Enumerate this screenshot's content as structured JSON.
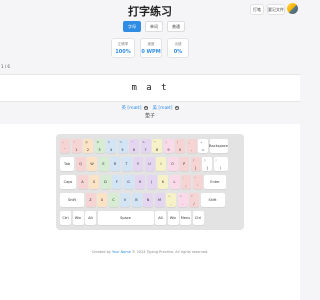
{
  "app": {
    "title": "打字练习"
  },
  "top_buttons": {
    "tab1": "打笔",
    "tab2": "要记文件"
  },
  "modes": [
    "字母",
    "单词",
    "普通"
  ],
  "stats": [
    {
      "label": "正确率",
      "value": "100%"
    },
    {
      "label": "速度",
      "value": "0 WPM"
    },
    {
      "label": "出错",
      "value": "0%"
    }
  ],
  "progress": "1 / 6",
  "word": "m a t",
  "phonetics": [
    {
      "label": "英 [mæt]"
    },
    {
      "label": "美 [mæt]"
    }
  ],
  "meaning": "垫子",
  "keyboard": {
    "row1": [
      {
        "s": "~",
        "m": "`",
        "c": "c1",
        "w": 10
      },
      {
        "s": "!",
        "m": "1",
        "c": "c1",
        "w": 10
      },
      {
        "s": "@",
        "m": "2",
        "c": "c2",
        "w": 10
      },
      {
        "s": "#",
        "m": "3",
        "c": "c3",
        "w": 10
      },
      {
        "s": "$",
        "m": "4",
        "c": "c4",
        "w": 10
      },
      {
        "s": "%",
        "m": "5",
        "c": "c4",
        "w": 10
      },
      {
        "s": "^",
        "m": "6",
        "c": "c5",
        "w": 10
      },
      {
        "s": "&",
        "m": "7",
        "c": "c5",
        "w": 10
      },
      {
        "s": "*",
        "m": "8",
        "c": "c6",
        "w": 10
      },
      {
        "s": "(",
        "m": "9",
        "c": "c7",
        "w": 10
      },
      {
        "s": ")",
        "m": "0",
        "c": "c1",
        "w": 10
      },
      {
        "s": "_",
        "m": "-",
        "c": "c1",
        "w": 10
      },
      {
        "s": "+",
        "m": "=",
        "c": "",
        "w": 10
      },
      {
        "s": "",
        "m": "Backspace",
        "c": "",
        "w": 18
      }
    ],
    "row2": [
      {
        "s": "",
        "m": "Tab",
        "c": "",
        "w": 14
      },
      {
        "s": "",
        "m": "Q",
        "c": "c1",
        "w": 10
      },
      {
        "s": "",
        "m": "W",
        "c": "c2",
        "w": 10
      },
      {
        "s": "",
        "m": "E",
        "c": "c3",
        "w": 10
      },
      {
        "s": "",
        "m": "R",
        "c": "c4",
        "w": 10
      },
      {
        "s": "",
        "m": "T",
        "c": "c4",
        "w": 10
      },
      {
        "s": "",
        "m": "Y",
        "c": "c5",
        "w": 10
      },
      {
        "s": "",
        "m": "U",
        "c": "c5",
        "w": 10
      },
      {
        "s": "",
        "m": "I",
        "c": "c6",
        "w": 10
      },
      {
        "s": "",
        "m": "O",
        "c": "c7",
        "w": 10
      },
      {
        "s": "",
        "m": "P",
        "c": "c1",
        "w": 10
      },
      {
        "s": "{",
        "m": "[",
        "c": "c1",
        "w": 10
      },
      {
        "s": "}",
        "m": "]",
        "c": "",
        "w": 10
      },
      {
        "s": "|",
        "m": "\\",
        "c": "",
        "w": 14
      }
    ],
    "row3": [
      {
        "s": "",
        "m": "Caps",
        "c": "",
        "w": 16
      },
      {
        "s": "",
        "m": "A",
        "c": "c1",
        "w": 10
      },
      {
        "s": "",
        "m": "S",
        "c": "c2",
        "w": 10
      },
      {
        "s": "",
        "m": "D",
        "c": "c3",
        "w": 10
      },
      {
        "s": "",
        "m": "F",
        "c": "c4",
        "w": 10
      },
      {
        "s": "",
        "m": "G",
        "c": "c4",
        "w": 10
      },
      {
        "s": "",
        "m": "H",
        "c": "c5",
        "w": 10
      },
      {
        "s": "",
        "m": "J",
        "c": "c5",
        "w": 10
      },
      {
        "s": "",
        "m": "K",
        "c": "c6",
        "w": 10
      },
      {
        "s": "",
        "m": "L",
        "c": "c7",
        "w": 10
      },
      {
        "s": ":",
        "m": ";",
        "c": "c1",
        "w": 10
      },
      {
        "s": "\"",
        "m": "'",
        "c": "c1",
        "w": 10
      },
      {
        "s": "",
        "m": "Enter",
        "c": "",
        "w": 22
      }
    ],
    "row4": [
      {
        "s": "",
        "m": "Shift",
        "c": "",
        "w": 24
      },
      {
        "s": "",
        "m": "Z",
        "c": "c1",
        "w": 10
      },
      {
        "s": "",
        "m": "X",
        "c": "c2",
        "w": 10
      },
      {
        "s": "",
        "m": "C",
        "c": "c3",
        "w": 10
      },
      {
        "s": "",
        "m": "V",
        "c": "c4",
        "w": 10
      },
      {
        "s": "",
        "m": "B",
        "c": "c4",
        "w": 10
      },
      {
        "s": "",
        "m": "N",
        "c": "c5",
        "w": 10
      },
      {
        "s": "",
        "m": "M",
        "c": "c5",
        "w": 10
      },
      {
        "s": "<",
        "m": ",",
        "c": "c6",
        "w": 10
      },
      {
        "s": ">",
        "m": ".",
        "c": "c7",
        "w": 10
      },
      {
        "s": "?",
        "m": "/",
        "c": "c1",
        "w": 10
      },
      {
        "s": "",
        "m": "Shift",
        "c": "",
        "w": 24
      }
    ],
    "row5": [
      {
        "s": "",
        "m": "Ctrl",
        "c": "",
        "w": 11
      },
      {
        "s": "",
        "m": "Win",
        "c": "",
        "w": 11
      },
      {
        "s": "",
        "m": "Alt",
        "c": "",
        "w": 11
      },
      {
        "s": "",
        "m": "Space",
        "c": "",
        "w": 56
      },
      {
        "s": "",
        "m": "Alt",
        "c": "",
        "w": 11
      },
      {
        "s": "",
        "m": "Win",
        "c": "",
        "w": 11
      },
      {
        "s": "",
        "m": "Menu",
        "c": "",
        "w": 11
      },
      {
        "s": "",
        "m": "Ctrl",
        "c": "",
        "w": 11
      }
    ]
  },
  "footer": {
    "prefix": "Created by ",
    "author": "Your Name",
    "suffix": " © 2024 Typing Practice. All rights reserved."
  }
}
